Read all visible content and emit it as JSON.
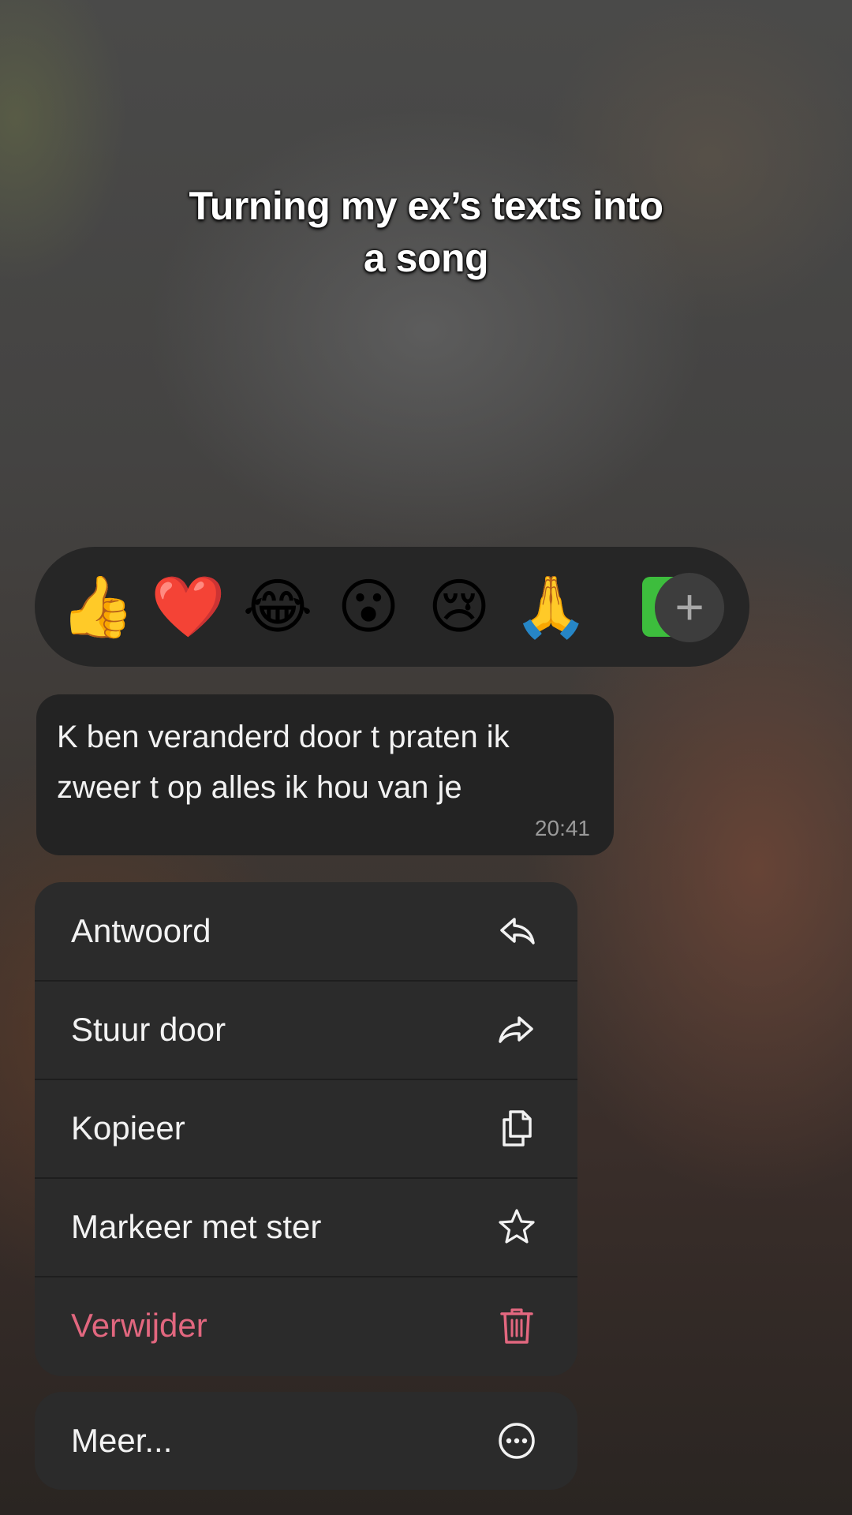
{
  "caption": {
    "line1": "Turning my ex’s texts into",
    "line2": "a song"
  },
  "reactions": {
    "items": [
      {
        "name": "thumbs-up",
        "glyph": "👍"
      },
      {
        "name": "red-heart",
        "glyph": "❤️"
      },
      {
        "name": "tears-of-joy",
        "glyph": "😂"
      },
      {
        "name": "surprised",
        "glyph": "😮"
      },
      {
        "name": "crying",
        "glyph": "😢"
      },
      {
        "name": "folded-hands",
        "glyph": "🙏"
      },
      {
        "name": "check-mark",
        "glyph": "✓"
      }
    ],
    "more_icon": "plus-icon",
    "more_glyph": "+"
  },
  "message": {
    "text": "K ben veranderd door t praten ik zweer t op alles ik hou van je",
    "time": "20:41"
  },
  "menu": {
    "items": [
      {
        "label": "Antwoord",
        "icon": "reply-icon"
      },
      {
        "label": "Stuur door",
        "icon": "forward-icon"
      },
      {
        "label": "Kopieer",
        "icon": "copy-icon"
      },
      {
        "label": "Markeer met ster",
        "icon": "star-icon"
      },
      {
        "label": "Verwijder",
        "icon": "trash-icon",
        "color": "#e2677f"
      }
    ],
    "more": {
      "label": "Meer...",
      "icon": "ellipsis-circle-icon"
    }
  },
  "colors": {
    "danger": "#e2677f",
    "surface": "#2b2b2b",
    "bubble": "#232323",
    "check_green": "#3dbd3d"
  }
}
